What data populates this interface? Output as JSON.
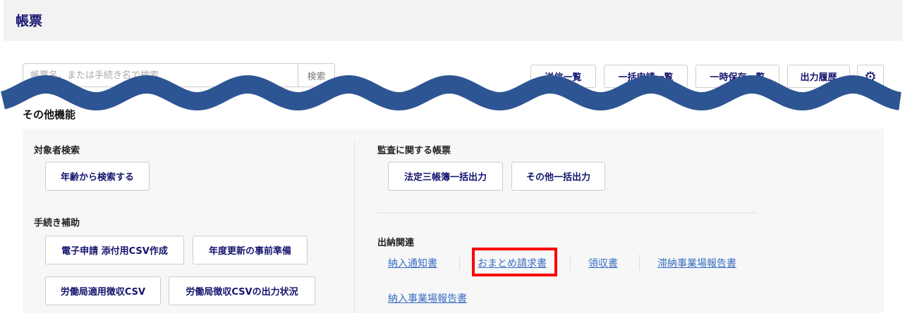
{
  "header": {
    "title": "帳票"
  },
  "search": {
    "placeholder": "帳票名、または手続き名で検索",
    "button": "検索"
  },
  "toolbar": {
    "sent_list": "送信一覧",
    "bulk_list": "一括申請一覧",
    "draft_list": "一時保存一覧",
    "output_history": "出力履歴"
  },
  "section_title": "その他機能",
  "left": {
    "subject_search": {
      "title": "対象者検索",
      "buttons": [
        "年齢から検索する"
      ]
    },
    "procedure_help": {
      "title": "手続き補助",
      "buttons": [
        "電子申請 添付用CSV作成",
        "年度更新の事前準備",
        "労働局適用徴収CSV",
        "労働局徴収CSVの出力状況"
      ]
    }
  },
  "right": {
    "audit": {
      "title": "監査に関する帳票",
      "buttons": [
        "法定三帳簿一括出力",
        "その他一括出力"
      ]
    },
    "accounting": {
      "title": "出納関連",
      "links": [
        "納入通知書",
        "おまとめ請求書",
        "領収書",
        "滞納事業場報告書",
        "納入事業場報告書"
      ]
    }
  },
  "colors": {
    "wave": "#2e5593",
    "highlight": "#ff0000",
    "link": "#3a6fc4"
  }
}
